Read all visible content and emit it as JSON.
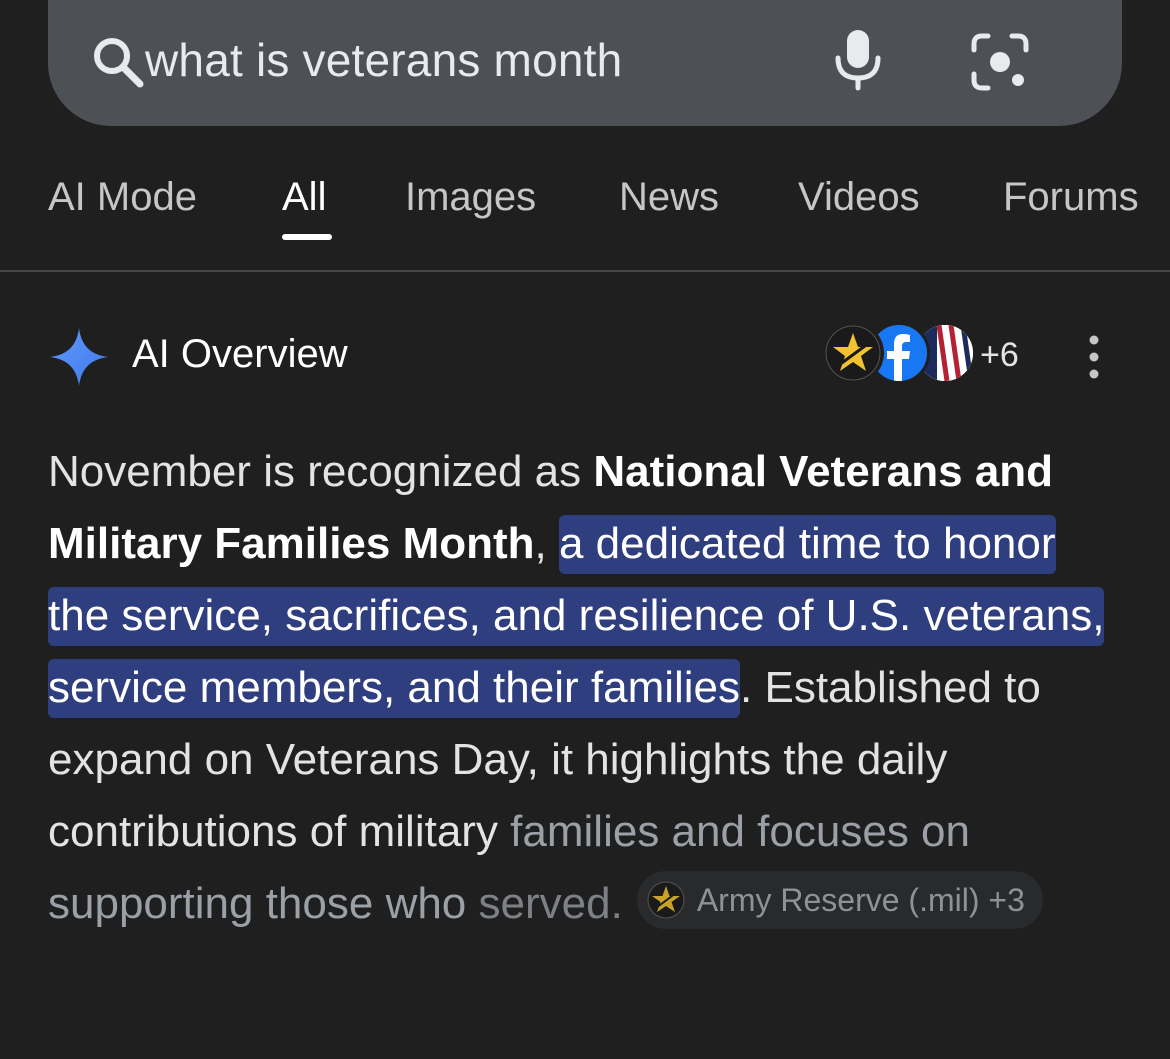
{
  "search": {
    "query": "what is veterans month"
  },
  "tabs": [
    {
      "label": "AI Mode"
    },
    {
      "label": "All"
    },
    {
      "label": "Images"
    },
    {
      "label": "News"
    },
    {
      "label": "Videos"
    },
    {
      "label": "Forums"
    }
  ],
  "active_tab": "All",
  "ai_overview": {
    "title": "AI Overview",
    "source_count": "+6",
    "text": {
      "p1_plain": "November is recognized as ",
      "p1_bold": "National Veterans and Military Families Month",
      "p1_comma": ", ",
      "p1_highlight": "a dedicated time to honor the service, sacrifices, and resilience of U.S. veterans, service members, and their families",
      "p1_rest_a": ". Established to expand on Veterans Day, it highlights the daily contributions of military ",
      "p1_rest_b": "families and focuses on supporting those who ",
      "p1_rest_c": "served."
    },
    "citation": {
      "source": "Army Reserve (.mil)",
      "more": "+3"
    }
  },
  "colors": {
    "background": "#1f1f1f",
    "search_bar": "#4d5156",
    "highlight": "#2e3e7e",
    "sparkle_blue": "#4f8ff7"
  }
}
